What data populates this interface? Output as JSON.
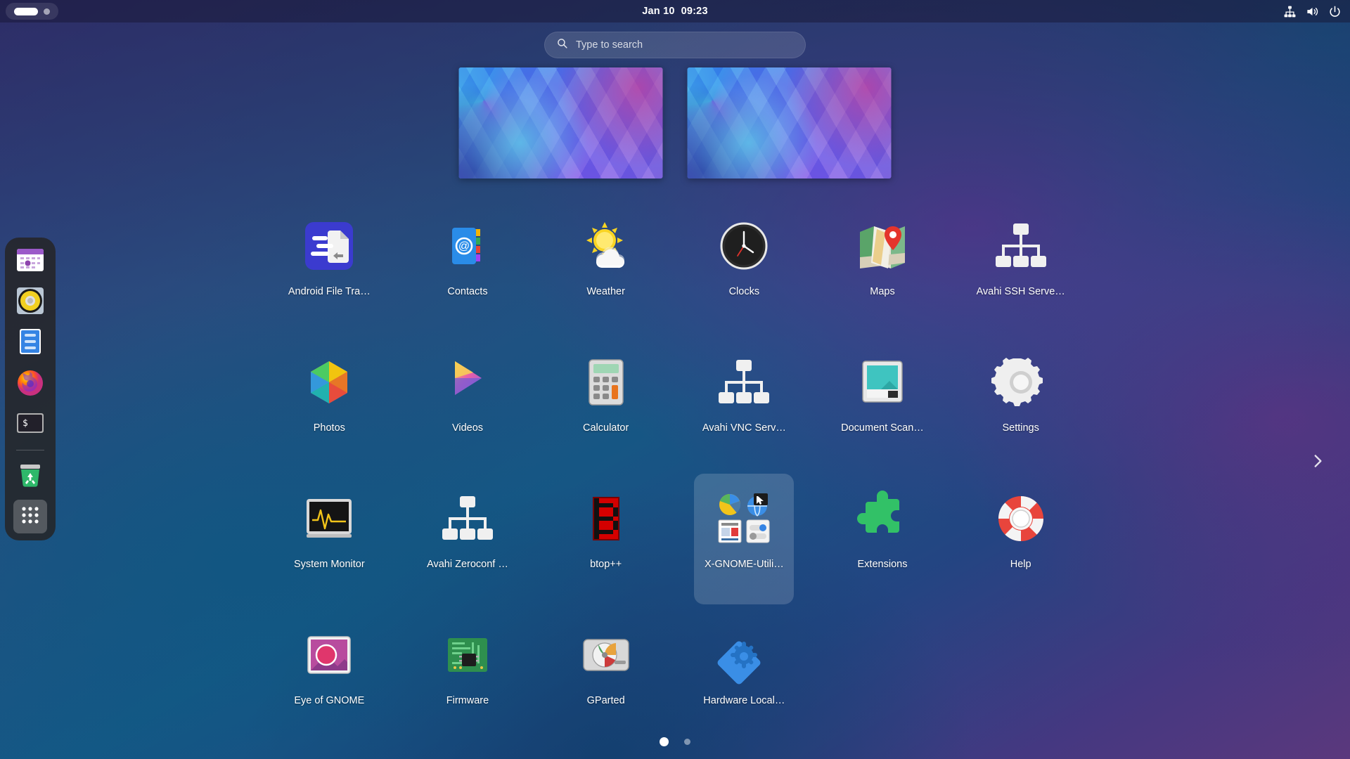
{
  "topbar": {
    "activities_label": "",
    "clock_date": "Jan 10",
    "clock_time": "09:23",
    "status_icons": [
      "network-wired-icon",
      "volume-icon",
      "power-icon"
    ]
  },
  "search": {
    "placeholder": "Type to search",
    "value": "",
    "icon": "search-icon"
  },
  "workspaces": {
    "count": 2,
    "items": [
      {
        "name": "workspace-1",
        "active": true
      },
      {
        "name": "workspace-2",
        "active": false
      }
    ]
  },
  "dock": {
    "items": [
      {
        "name": "calendar",
        "label": "Calendar",
        "icon": "calendar-icon"
      },
      {
        "name": "rhythmbox",
        "label": "Rhythmbox",
        "icon": "music-player-icon"
      },
      {
        "name": "files",
        "label": "Files",
        "icon": "file-manager-icon"
      },
      {
        "name": "firefox",
        "label": "Firefox",
        "icon": "firefox-icon"
      },
      {
        "name": "terminal",
        "label": "Terminal",
        "icon": "terminal-icon"
      },
      {
        "name": "trash",
        "label": "Trash",
        "icon": "trash-icon"
      }
    ],
    "show_apps_label": "Show Applications",
    "show_apps_icon": "app-grid-icon"
  },
  "grid": {
    "apps": [
      {
        "label": "Android File Tra…",
        "icon": "android-file-transfer-icon",
        "selected": false
      },
      {
        "label": "Contacts",
        "icon": "contacts-icon",
        "selected": false
      },
      {
        "label": "Weather",
        "icon": "weather-icon",
        "selected": false
      },
      {
        "label": "Clocks",
        "icon": "clocks-icon",
        "selected": false
      },
      {
        "label": "Maps",
        "icon": "maps-icon",
        "selected": false
      },
      {
        "label": "Avahi SSH Serve…",
        "icon": "avahi-ssh-icon",
        "selected": false
      },
      {
        "label": "Photos",
        "icon": "photos-icon",
        "selected": false
      },
      {
        "label": "Videos",
        "icon": "videos-icon",
        "selected": false
      },
      {
        "label": "Calculator",
        "icon": "calculator-icon",
        "selected": false
      },
      {
        "label": "Avahi VNC Serv…",
        "icon": "avahi-vnc-icon",
        "selected": false
      },
      {
        "label": "Document Scan…",
        "icon": "document-scanner-icon",
        "selected": false
      },
      {
        "label": "Settings",
        "icon": "settings-gear-icon",
        "selected": false
      },
      {
        "label": "System Monitor",
        "icon": "system-monitor-icon",
        "selected": false
      },
      {
        "label": "Avahi Zeroconf …",
        "icon": "avahi-zeroconf-icon",
        "selected": false
      },
      {
        "label": "btop++",
        "icon": "btop-icon",
        "selected": false
      },
      {
        "label": "X-GNOME-Utili…",
        "icon": "folder-utilities-icon",
        "selected": true
      },
      {
        "label": "Extensions",
        "icon": "extensions-puzzle-icon",
        "selected": false
      },
      {
        "label": "Help",
        "icon": "help-lifering-icon",
        "selected": false
      },
      {
        "label": "Eye of GNOME",
        "icon": "eye-of-gnome-icon",
        "selected": false
      },
      {
        "label": "Firmware",
        "icon": "firmware-icon",
        "selected": false
      },
      {
        "label": "GParted",
        "icon": "gparted-icon",
        "selected": false
      },
      {
        "label": "Hardware Local…",
        "icon": "hardware-localization-icon",
        "selected": false
      }
    ]
  },
  "pagination": {
    "pages": 2,
    "current_page": 1,
    "next_icon": "chevron-right-icon"
  },
  "colors": {
    "accent": "#3584e4",
    "topbar_bg": "#1c1833",
    "dock_bg": "#262426",
    "selection": "#ffffff29"
  }
}
